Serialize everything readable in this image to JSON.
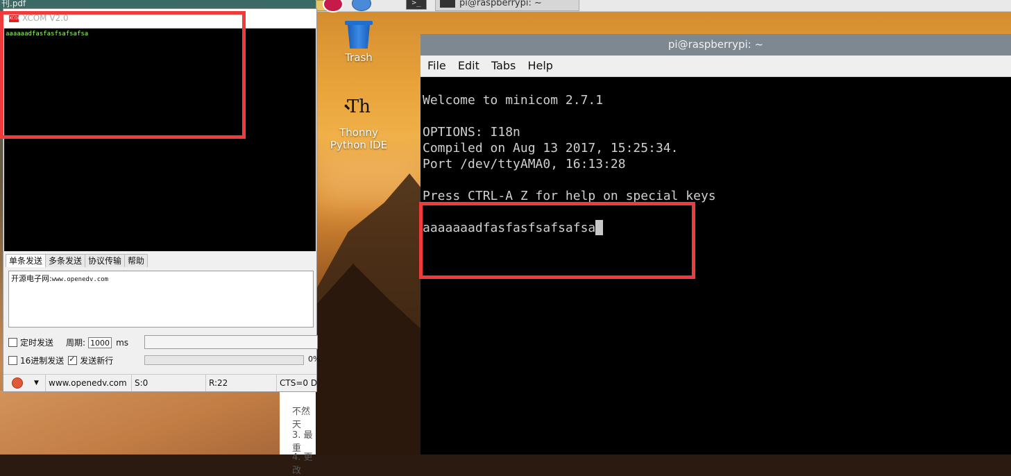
{
  "corner_text": "刊.pdf",
  "rpi": {
    "taskbar": {
      "task_label": "pi@raspberrypi: ~",
      "term_glyph": ">_"
    },
    "desktop_icons": [
      {
        "label": "Trash"
      },
      {
        "label_line1": "Thonny",
        "label_line2": "Python IDE",
        "glyph": "Th"
      }
    ],
    "terminal": {
      "title": "pi@raspberrypi: ~",
      "menu": [
        "File",
        "Edit",
        "Tabs",
        "Help"
      ],
      "lines": [
        "Welcome to minicom 2.7.1",
        "",
        "OPTIONS: I18n",
        "Compiled on Aug 13 2017, 15:25:34.",
        "Port /dev/ttyAMA0, 16:13:28",
        "",
        "Press CTRL-A Z for help on special keys",
        ""
      ],
      "received": "aaaaaaadfasfasfsafsafsa"
    }
  },
  "docstrip": {
    "line1": "不然天",
    "line2": "3. 最重",
    "line3": "4. 更改"
  },
  "xcom": {
    "title": "XCOM V2.0",
    "logo_text": "XCOM",
    "receive_text": "aaaaaadfasfasfsafsafsa",
    "tabs": [
      "单条发送",
      "多条发送",
      "协议传输",
      "帮助"
    ],
    "send_text": "开源电子网:",
    "send_text_url": "www.openedv.com",
    "timed_send_label": "定时发送",
    "period_label": "周期:",
    "period_value": "1000",
    "period_unit": "ms",
    "hex_send_label": "16进制发送",
    "newline_label": "发送新行",
    "percent": "0%",
    "status": {
      "url": "www.openedv.com",
      "sent": "S:0",
      "received": "R:22",
      "cts": "CTS=0 D"
    }
  }
}
